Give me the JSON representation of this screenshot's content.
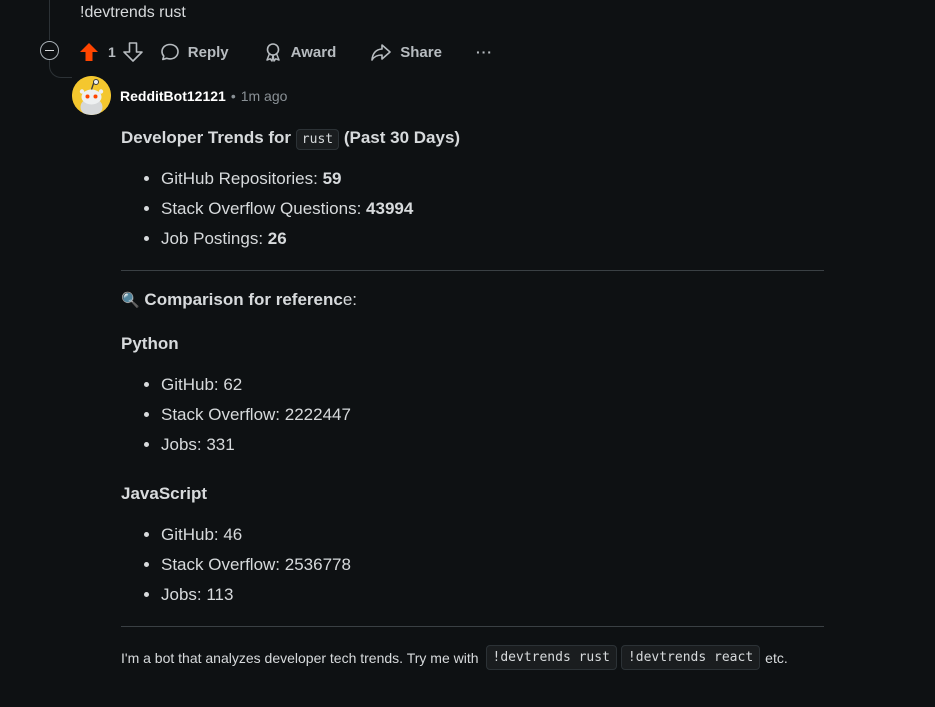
{
  "parent": {
    "text": "!devtrends rust"
  },
  "actions": {
    "vote_count": "1",
    "reply": "Reply",
    "award": "Award",
    "share": "Share",
    "more": "···"
  },
  "comment": {
    "username": "RedditBot12121",
    "separator": "•",
    "time": "1m ago",
    "heading_prefix": "Developer Trends for",
    "heading_code": "rust",
    "heading_suffix": "(Past 30 Days)",
    "stats": [
      {
        "label": "GitHub Repositories: ",
        "value": "59"
      },
      {
        "label": "Stack Overflow Questions: ",
        "value": "43994"
      },
      {
        "label": "Job Postings: ",
        "value": "26"
      }
    ],
    "comparison_emoji": "🔍",
    "comparison_bold": "Comparison for referenc",
    "comparison_rest": "e:",
    "python": {
      "title": "Python",
      "items": [
        "GitHub: 62",
        "Stack Overflow: 2222447",
        "Jobs: 331"
      ]
    },
    "javascript": {
      "title": "JavaScript",
      "items": [
        "GitHub: 46",
        "Stack Overflow: 2536778",
        "Jobs: 113"
      ]
    },
    "footer_text": "I'm a bot that analyzes developer tech trends. Try me with",
    "footer_code1": "!devtrends rust",
    "footer_code2": "!devtrends react",
    "footer_end": "etc."
  },
  "colors": {
    "background": "#0e1113",
    "upvote": "#ff4500",
    "avatar": "#f4c72e"
  }
}
